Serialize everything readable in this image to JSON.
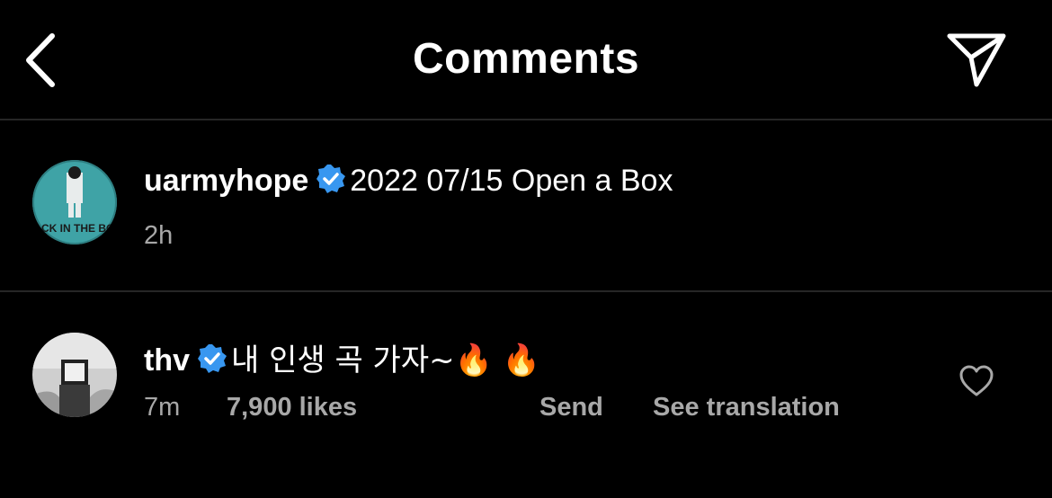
{
  "header": {
    "title": "Comments",
    "back_icon": "chevron-left-icon",
    "send_icon": "paper-plane-icon"
  },
  "post": {
    "username": "uarmyhope",
    "verified": true,
    "caption": "2022 07/15 Open a Box",
    "time": "2h",
    "avatar_text": "JACK IN THE BOX",
    "avatar_color": "#3fa3a6"
  },
  "comments": [
    {
      "username": "thv",
      "verified": true,
      "text": "내 인생 곡 가자~🔥 🔥",
      "time": "7m",
      "likes": "7,900 likes",
      "send_label": "Send",
      "translate_label": "See translation",
      "like_icon": "heart-outline-icon"
    }
  ],
  "colors": {
    "background": "#000000",
    "text": "#ffffff",
    "secondary": "#a8a8a8",
    "divider": "#262626",
    "verified": "#3897f0"
  }
}
